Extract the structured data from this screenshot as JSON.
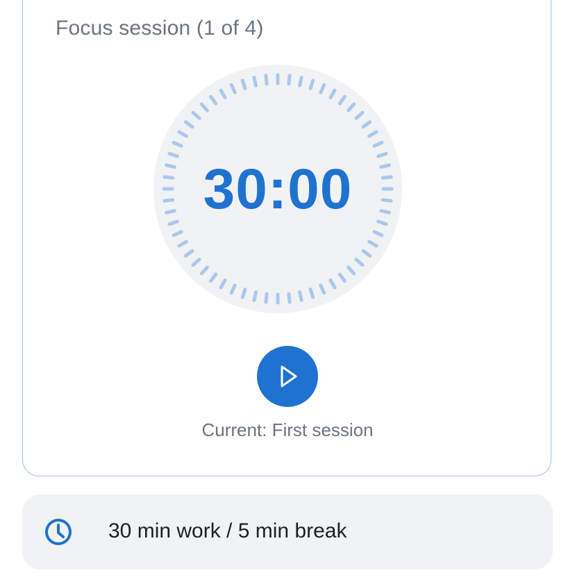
{
  "header": {
    "session_title": "Focus session (1 of 4)"
  },
  "timer": {
    "display": "30:00",
    "tick_count": 60,
    "progress": 0
  },
  "controls": {
    "play_icon": "play-icon"
  },
  "status": {
    "current": "Current: First session"
  },
  "info": {
    "icon": "clock-icon",
    "text": "30 min work / 5 min break"
  },
  "colors": {
    "accent": "#1f72d0",
    "tick": "#a9c8ec",
    "dial_bg": "#f0f2f4",
    "muted_text": "#6b7480",
    "card_border": "#9fc0e6",
    "info_bg": "#f0f2f4"
  }
}
